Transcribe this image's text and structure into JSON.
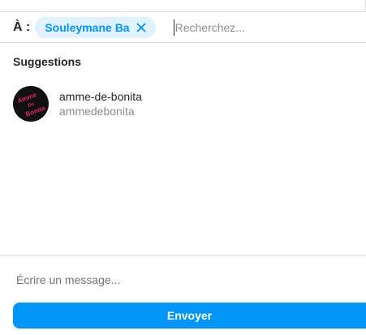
{
  "recipients": {
    "to_label": "À :",
    "chips": [
      {
        "label": "Souleymane Ba"
      }
    ],
    "search_placeholder": "Recherchez..."
  },
  "suggestions": {
    "title": "Suggestions",
    "items": [
      {
        "name": "amme-de-bonita",
        "handle": "ammedebonita",
        "avatar_text": [
          "Amme",
          "De",
          "Bonita"
        ]
      }
    ]
  },
  "composer": {
    "placeholder": "Écrire un message...",
    "send_label": "Envoyer"
  },
  "colors": {
    "accent": "#0095f6",
    "chip_bg": "#e0f1ff",
    "divider": "#dbdbdb",
    "avatar_text": "#e0245e"
  },
  "icons": {
    "chip_remove": "close-icon"
  }
}
